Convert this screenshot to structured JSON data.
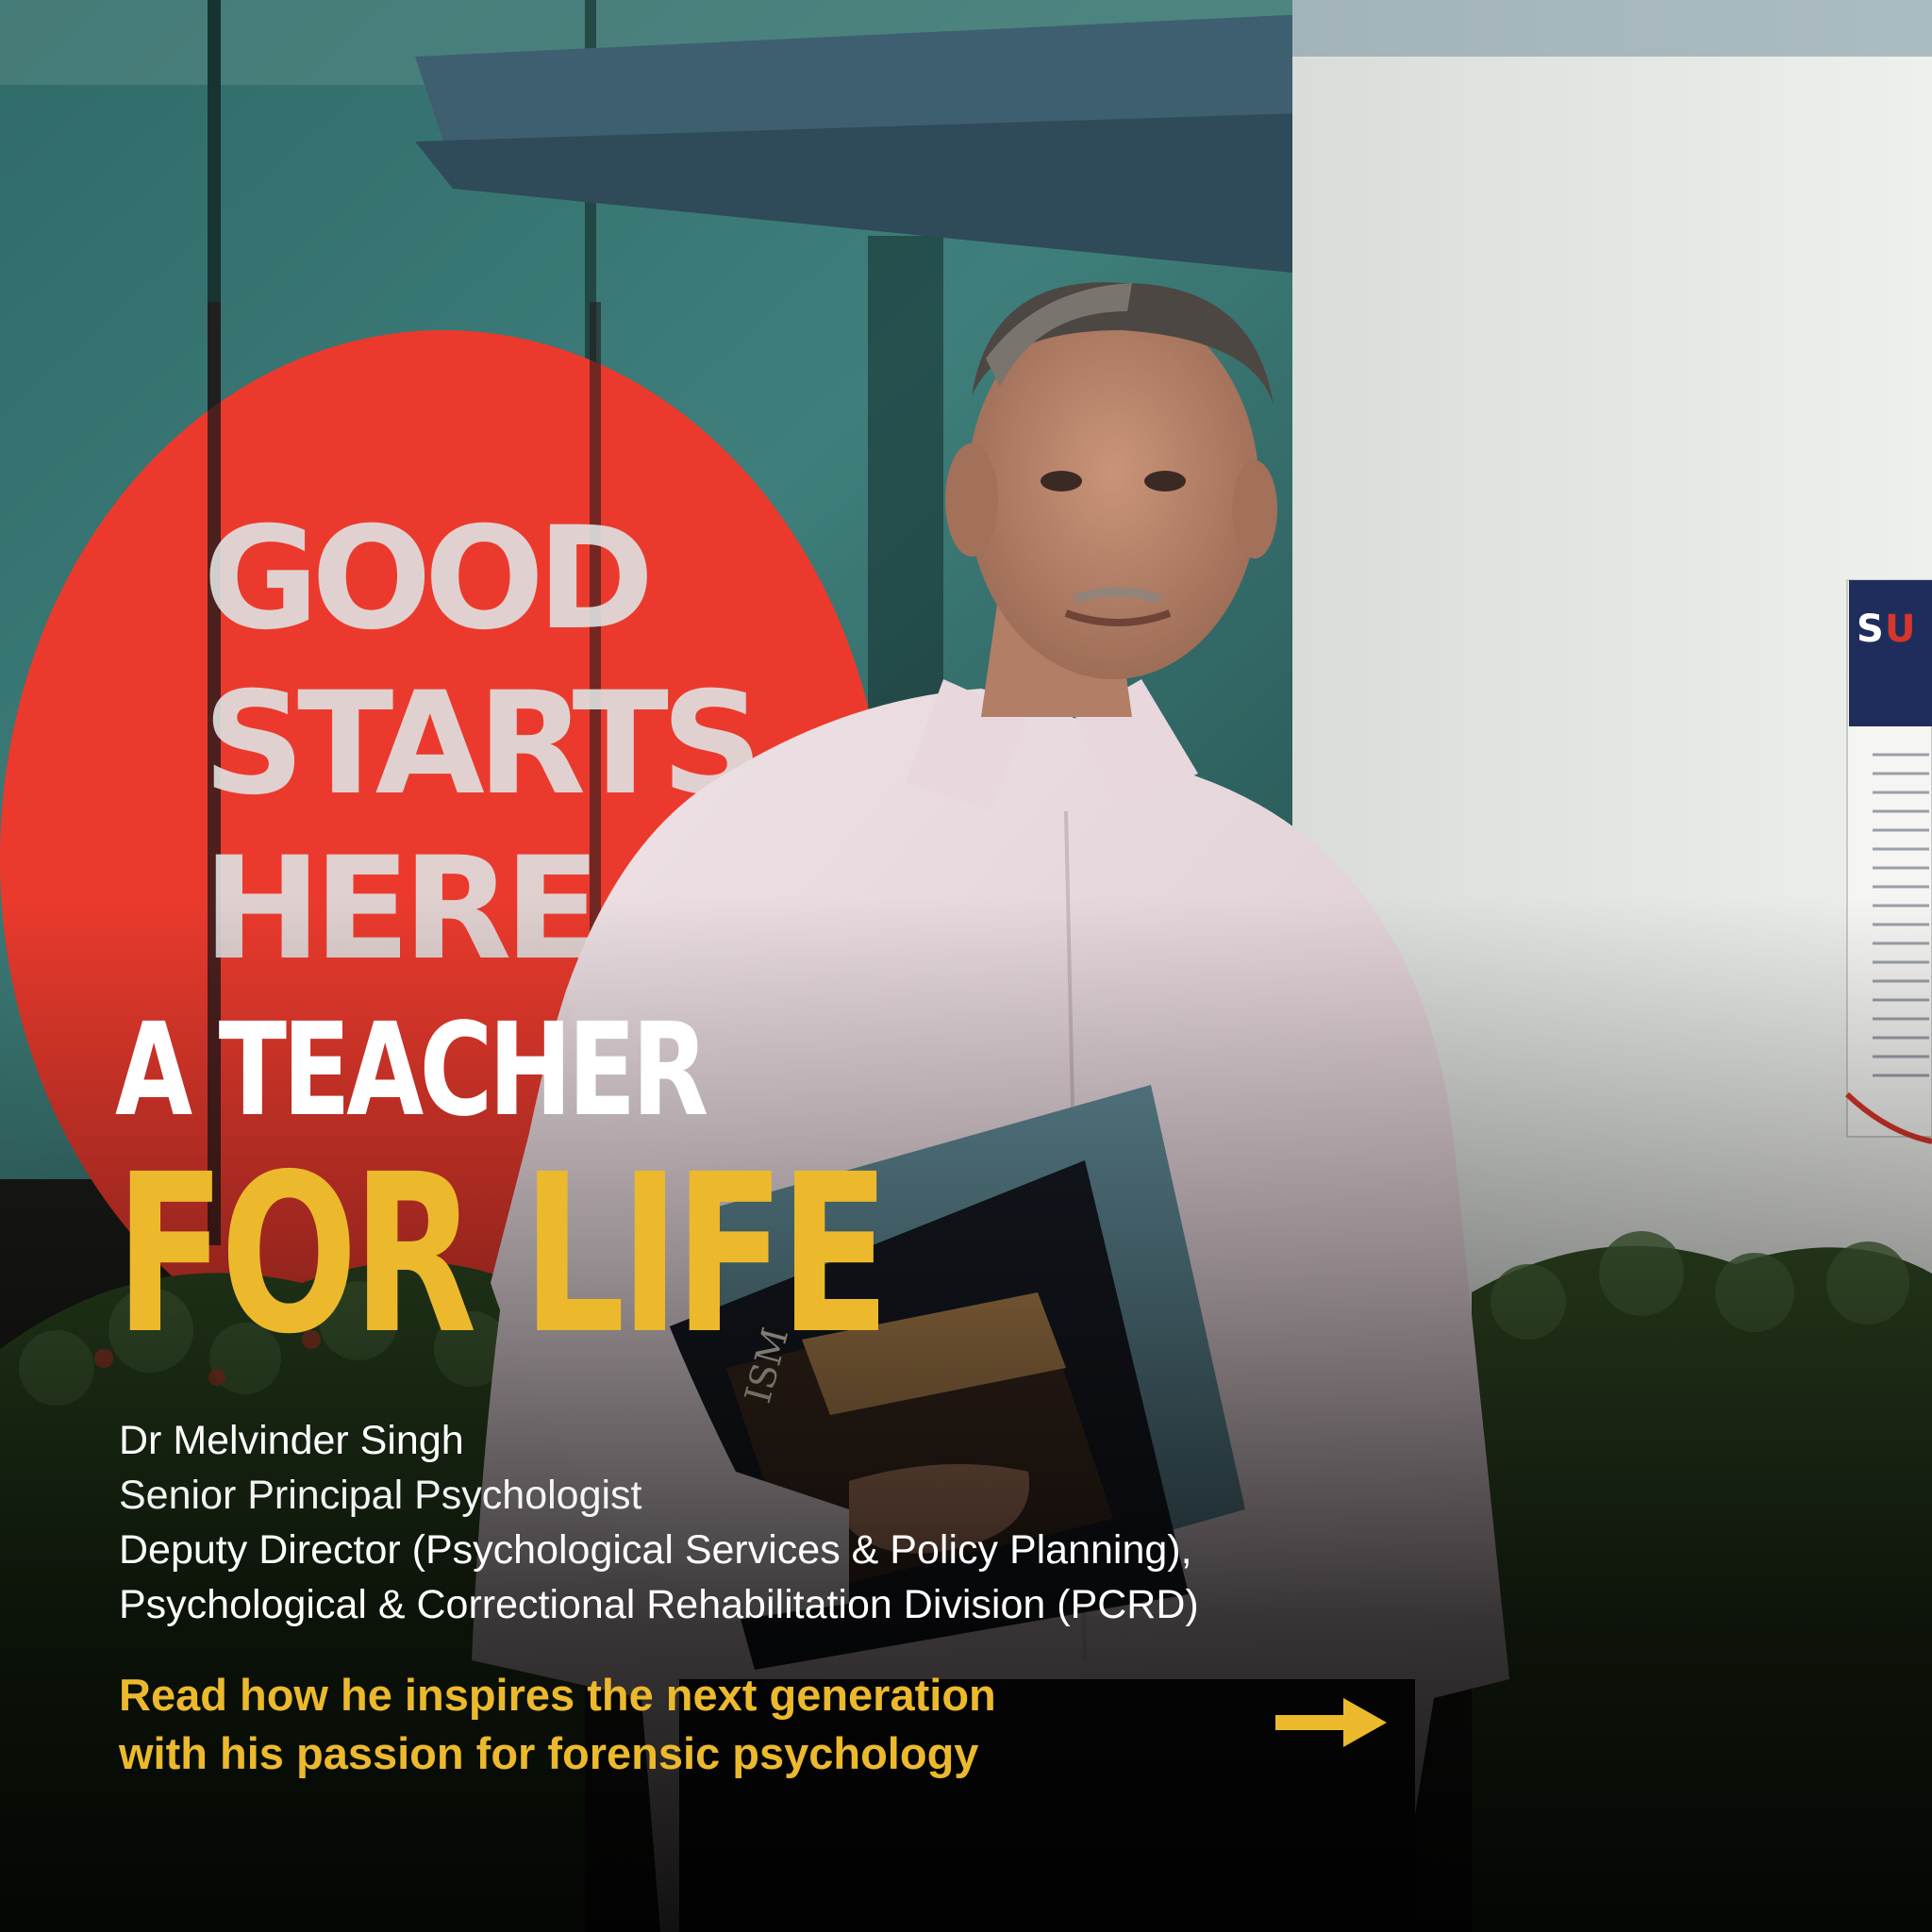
{
  "headline": {
    "line1": "A TEACHER",
    "line2": "FOR LIFE"
  },
  "sign_text": [
    "GOOD",
    "STARTS",
    "HERE."
  ],
  "person": {
    "name": "Dr Melvinder Singh",
    "title1": "Senior Principal Psychologist",
    "title2": "Deputy Director (Psychological Services & Policy Planning),",
    "title3": "Psychological & Correctional Rehabilitation Division (PCRD)"
  },
  "cta": {
    "line1": "Read how he inspires the next generation",
    "line2": "with his passion for forensic psychology",
    "arrow_icon": "arrow-right-icon"
  },
  "colors": {
    "accent_yellow": "#ecb92d",
    "sign_red": "#e8352a",
    "text_white": "#ffffff"
  }
}
